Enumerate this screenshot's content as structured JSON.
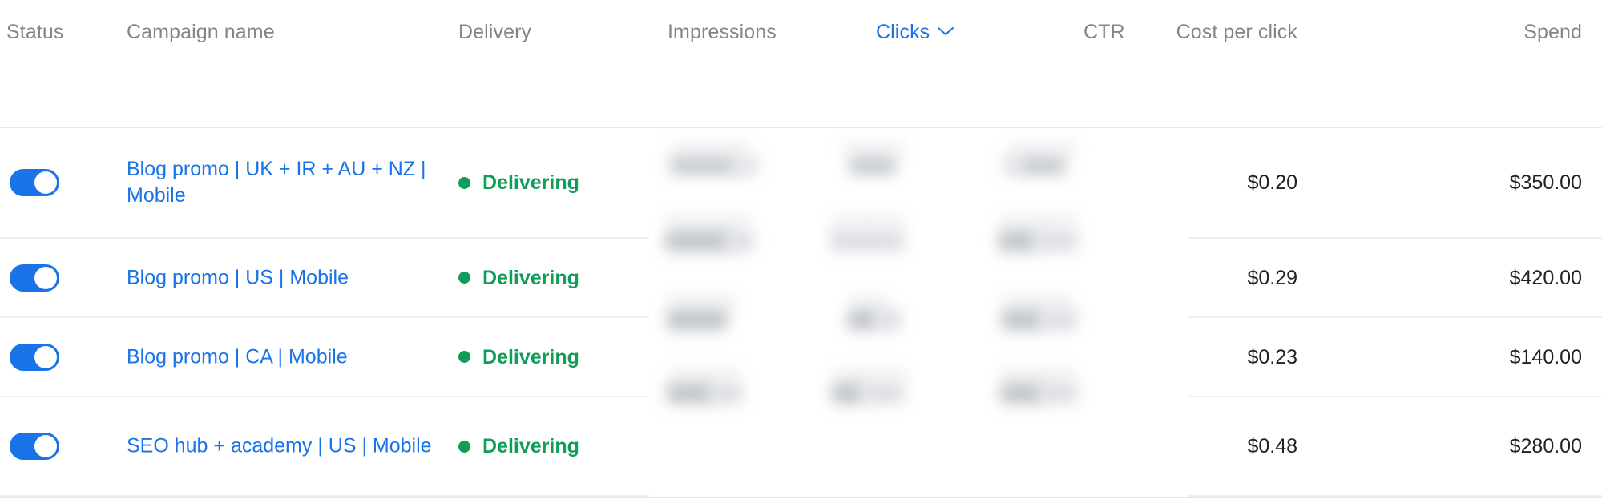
{
  "table": {
    "columns": [
      {
        "key": "status",
        "label": "Status",
        "align": "left",
        "sorted": false,
        "icon": null
      },
      {
        "key": "campaign",
        "label": "Campaign name",
        "align": "left",
        "sorted": false,
        "icon": null
      },
      {
        "key": "delivery",
        "label": "Delivery",
        "align": "left",
        "sorted": false,
        "icon": null
      },
      {
        "key": "impressions",
        "label": "Impressions",
        "align": "left",
        "sorted": false,
        "icon": null
      },
      {
        "key": "clicks",
        "label": "Clicks",
        "align": "left",
        "sorted": true,
        "icon": "chevron-down-icon"
      },
      {
        "key": "ctr",
        "label": "CTR",
        "align": "left",
        "sorted": false,
        "icon": null
      },
      {
        "key": "cpc",
        "label": "Cost per click",
        "align": "right",
        "sorted": false,
        "icon": null
      },
      {
        "key": "spend",
        "label": "Spend",
        "align": "right",
        "sorted": false,
        "icon": null
      }
    ],
    "rows": [
      {
        "toggle_on": true,
        "campaign_name": "Blog promo | UK + IR + AU + NZ | Mobile",
        "delivery_status": "Delivering",
        "impressions": "",
        "clicks": "",
        "ctr": "",
        "cost_per_click": "$0.20",
        "spend": "$350.00"
      },
      {
        "toggle_on": true,
        "campaign_name": "Blog promo | US | Mobile",
        "delivery_status": "Delivering",
        "impressions": "",
        "clicks": "",
        "ctr": "",
        "cost_per_click": "$0.29",
        "spend": "$420.00"
      },
      {
        "toggle_on": true,
        "campaign_name": "Blog promo | CA | Mobile",
        "delivery_status": "Delivering",
        "impressions": "",
        "clicks": "",
        "ctr": "",
        "cost_per_click": "$0.23",
        "spend": "$140.00"
      },
      {
        "toggle_on": true,
        "campaign_name": "SEO hub + academy | US | Mobile",
        "delivery_status": "Delivering",
        "impressions": "",
        "clicks": "",
        "ctr": "",
        "cost_per_click": "$0.48",
        "spend": "$280.00"
      }
    ],
    "redacted_columns": [
      "Impressions",
      "Clicks",
      "CTR"
    ],
    "colors": {
      "link_blue": "#1a73e8",
      "toggle_on": "#1a73e8",
      "delivering_green": "#0f9d58",
      "header_grey": "#80868b",
      "value_text": "#202124",
      "row_border": "#eceff1"
    }
  }
}
